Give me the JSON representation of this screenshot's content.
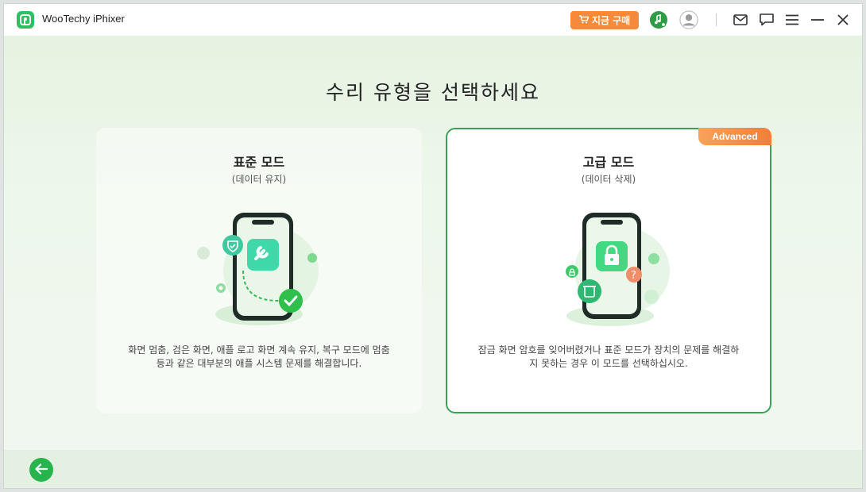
{
  "app": {
    "title": "WooTechy iPhixer"
  },
  "titlebar": {
    "buy_label": "지금 구매",
    "icons": [
      "music-search-icon",
      "account-icon",
      "mail-icon",
      "chat-icon",
      "menu-icon",
      "minimize-icon",
      "close-icon"
    ]
  },
  "main": {
    "heading": "수리 유형을 선택하세요",
    "cards": [
      {
        "title": "표준 모드",
        "subtitle": "(데이터 유지)",
        "description": "화면 멈춤, 검은 화면, 애플 로고 화면 계속 유지, 복구 모드에 멈춤 등과 같은 대부분의 애플 시스템 문제를 해결합니다.",
        "icon": "repair-phone-icon",
        "selected": false
      },
      {
        "title": "고급 모드",
        "subtitle": "(데이터 삭제)",
        "description": "잠금 화면 암호를 잊어버렸거나 표준 모드가 장치의 문제를 해결하지 못하는 경우 이 모드를 선택하십시오.",
        "badge": "Advanced",
        "icon": "locked-phone-icon",
        "selected": true
      }
    ]
  },
  "footer": {
    "back_icon": "arrow-left-icon"
  },
  "colors": {
    "accent": "#2fbf62",
    "buy": "#f58a3c",
    "badge": "#f07f3a",
    "selected_border": "#3aa255"
  }
}
